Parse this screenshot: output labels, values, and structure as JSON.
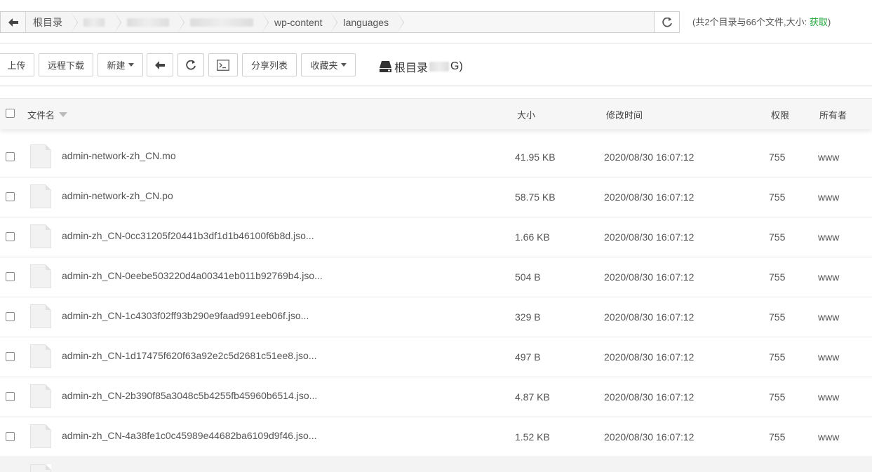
{
  "address_bar": {
    "back_icon": "arrow-left-icon",
    "crumbs": [
      "根目录",
      "",
      "",
      "",
      "wp-content",
      "languages"
    ],
    "refresh_icon": "refresh-icon"
  },
  "summary": {
    "text": "(共2个目录与66个文件,大小: ",
    "link": "获取",
    "close": ")"
  },
  "toolbar": {
    "upload": "上传",
    "remote_download": "远程下载",
    "new": "新建",
    "back_icon": "arrow-left-icon",
    "refresh_icon": "refresh-icon",
    "terminal_icon": "terminal-icon",
    "share_list": "分享列表",
    "favorites": "收藏夹",
    "disk_label": "根目录",
    "disk_suffix": "G)"
  },
  "table": {
    "headers": {
      "name": "文件名",
      "size": "大小",
      "mtime": "修改时间",
      "perm": "权限",
      "owner": "所有者"
    },
    "rows": [
      {
        "name": "admin-network-zh_CN.mo",
        "size": "41.95 KB",
        "mtime": "2020/08/30 16:07:12",
        "perm": "755",
        "owner": "www"
      },
      {
        "name": "admin-network-zh_CN.po",
        "size": "58.75 KB",
        "mtime": "2020/08/30 16:07:12",
        "perm": "755",
        "owner": "www"
      },
      {
        "name": "admin-zh_CN-0cc31205f20441b3df1d1b46100f6b8d.jso...",
        "size": "1.66 KB",
        "mtime": "2020/08/30 16:07:12",
        "perm": "755",
        "owner": "www"
      },
      {
        "name": "admin-zh_CN-0eebe503220d4a00341eb011b92769b4.jso...",
        "size": "504 B",
        "mtime": "2020/08/30 16:07:12",
        "perm": "755",
        "owner": "www"
      },
      {
        "name": "admin-zh_CN-1c4303f02ff93b290e9faad991eeb06f.jso...",
        "size": "329 B",
        "mtime": "2020/08/30 16:07:12",
        "perm": "755",
        "owner": "www"
      },
      {
        "name": "admin-zh_CN-1d17475f620f63a92e2c5d2681c51ee8.jso...",
        "size": "497 B",
        "mtime": "2020/08/30 16:07:12",
        "perm": "755",
        "owner": "www"
      },
      {
        "name": "admin-zh_CN-2b390f85a3048c5b4255fb45960b6514.jso...",
        "size": "4.87 KB",
        "mtime": "2020/08/30 16:07:12",
        "perm": "755",
        "owner": "www"
      },
      {
        "name": "admin-zh_CN-4a38fe1c0c45989e44682ba6109d9f46.jso...",
        "size": "1.52 KB",
        "mtime": "2020/08/30 16:07:12",
        "perm": "755",
        "owner": "www"
      }
    ]
  }
}
